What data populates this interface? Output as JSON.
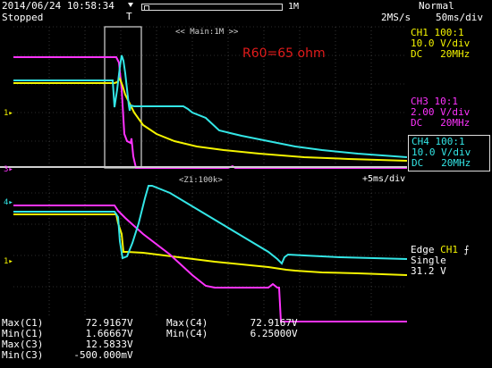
{
  "header": {
    "datetime": "2014/06/24 10:58:34",
    "status": "Stopped",
    "trigger_marker": "T",
    "record_marker_right": "1M",
    "trigger_mode": "Normal",
    "sample_rate": "2MS/s",
    "timebase": "50ms/div"
  },
  "channels": {
    "ch1": {
      "label": "CH1 100:1",
      "scale": "10.0 V/div",
      "coupling": "DC",
      "bw": "20MHz",
      "color": "#f4f400"
    },
    "ch3": {
      "label": "CH3 10:1",
      "scale": "2.00 V/div",
      "coupling": "DC",
      "bw": "20MHz",
      "color": "#ff33ff"
    },
    "ch4": {
      "label": "CH4 100:1",
      "scale": "10.0 V/div",
      "coupling": "DC",
      "bw": "20MHz",
      "color": "#33e6e6"
    }
  },
  "upper_panel": {
    "label": "<< Main:1M >>",
    "annotation": "R60=65 ohm"
  },
  "lower_panel": {
    "label": "<Z1:100k>",
    "timebase": "+5ms/div"
  },
  "trigger": {
    "type": "Edge",
    "channel": "CH1",
    "edge_icon": "rising-edge-icon",
    "mode": "Single",
    "level": "31.2 V"
  },
  "measurements": [
    {
      "label": "Max(C1)",
      "value": "72.9167V"
    },
    {
      "label": "Min(C1)",
      "value": "1.66667V"
    },
    {
      "label": "Max(C3)",
      "value": "12.5833V"
    },
    {
      "label": "Min(C3)",
      "value": "-500.000mV"
    },
    {
      "label": "Max(C4)",
      "value": "72.9167V"
    },
    {
      "label": "Min(C4)",
      "value": "6.25000V"
    }
  ],
  "ground_markers": {
    "ch1": "1",
    "ch3": "3",
    "ch4": "4"
  }
}
